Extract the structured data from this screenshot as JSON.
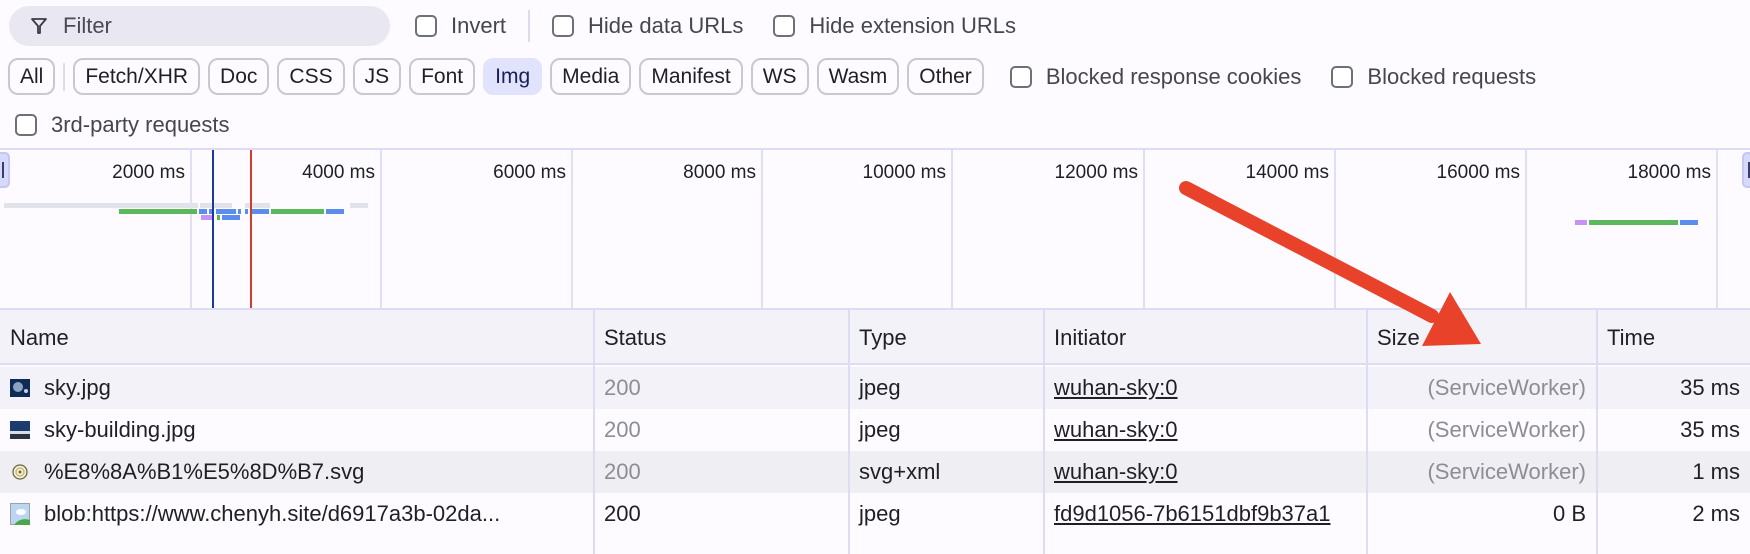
{
  "toolbar": {
    "filter_placeholder": "Filter",
    "filter_icon": "funnel-icon",
    "checkboxes": [
      {
        "label": "Invert",
        "checked": false
      },
      {
        "label": "Hide data URLs",
        "checked": false
      },
      {
        "label": "Hide extension URLs",
        "checked": false
      }
    ]
  },
  "type_filters": {
    "chips": [
      {
        "label": "All",
        "active": false
      },
      {
        "label": "Fetch/XHR",
        "active": false
      },
      {
        "label": "Doc",
        "active": false
      },
      {
        "label": "CSS",
        "active": false
      },
      {
        "label": "JS",
        "active": false
      },
      {
        "label": "Font",
        "active": false
      },
      {
        "label": "Img",
        "active": true
      },
      {
        "label": "Media",
        "active": false
      },
      {
        "label": "Manifest",
        "active": false
      },
      {
        "label": "WS",
        "active": false
      },
      {
        "label": "Wasm",
        "active": false
      },
      {
        "label": "Other",
        "active": false
      }
    ],
    "blocked_response_cookies": {
      "label": "Blocked response cookies",
      "checked": false
    },
    "blocked_requests": {
      "label": "Blocked requests",
      "checked": false
    },
    "third_party": {
      "label": "3rd-party requests",
      "checked": false
    }
  },
  "overview": {
    "ticks": [
      "2000 ms",
      "4000 ms",
      "6000 ms",
      "8000 ms",
      "10000 ms",
      "12000 ms",
      "14000 ms",
      "16000 ms",
      "18000 ms"
    ],
    "dom_content_loaded_ms": 2200,
    "load_ms": 2600,
    "colors": {
      "dcl": "#1a3a9c",
      "load": "#d23b2f",
      "waiting": "#5b8def",
      "download": "#5cb85c",
      "queue": "#c792f5",
      "stalled": "#e2e2ea"
    }
  },
  "table": {
    "columns": [
      "Name",
      "Status",
      "Type",
      "Initiator",
      "Size",
      "Time"
    ],
    "rows": [
      {
        "icon": "image-thumbnail-icon",
        "name": "sky.jpg",
        "status": "200",
        "type": "jpeg",
        "initiator": "wuhan-sky:0",
        "size": "(ServiceWorker)",
        "time": "35 ms",
        "muted": true
      },
      {
        "icon": "image-thumbnail-icon",
        "name": "sky-building.jpg",
        "status": "200",
        "type": "jpeg",
        "initiator": "wuhan-sky:0",
        "size": "(ServiceWorker)",
        "time": "35 ms",
        "muted": true
      },
      {
        "icon": "svg-thumbnail-icon",
        "name": "%E8%8A%B1%E5%8D%B7.svg",
        "status": "200",
        "type": "svg+xml",
        "initiator": "wuhan-sky:0",
        "size": "(ServiceWorker)",
        "time": "1 ms",
        "muted": true
      },
      {
        "icon": "image-placeholder-icon",
        "name": "blob:https://www.chenyh.site/d6917a3b-02da...",
        "status": "200",
        "type": "jpeg",
        "initiator": "fd9d1056-7b6151dbf9b37a1",
        "size": "0 B",
        "time": "2 ms",
        "muted": false
      }
    ]
  },
  "annotation": {
    "arrow_color": "#e8422a"
  }
}
